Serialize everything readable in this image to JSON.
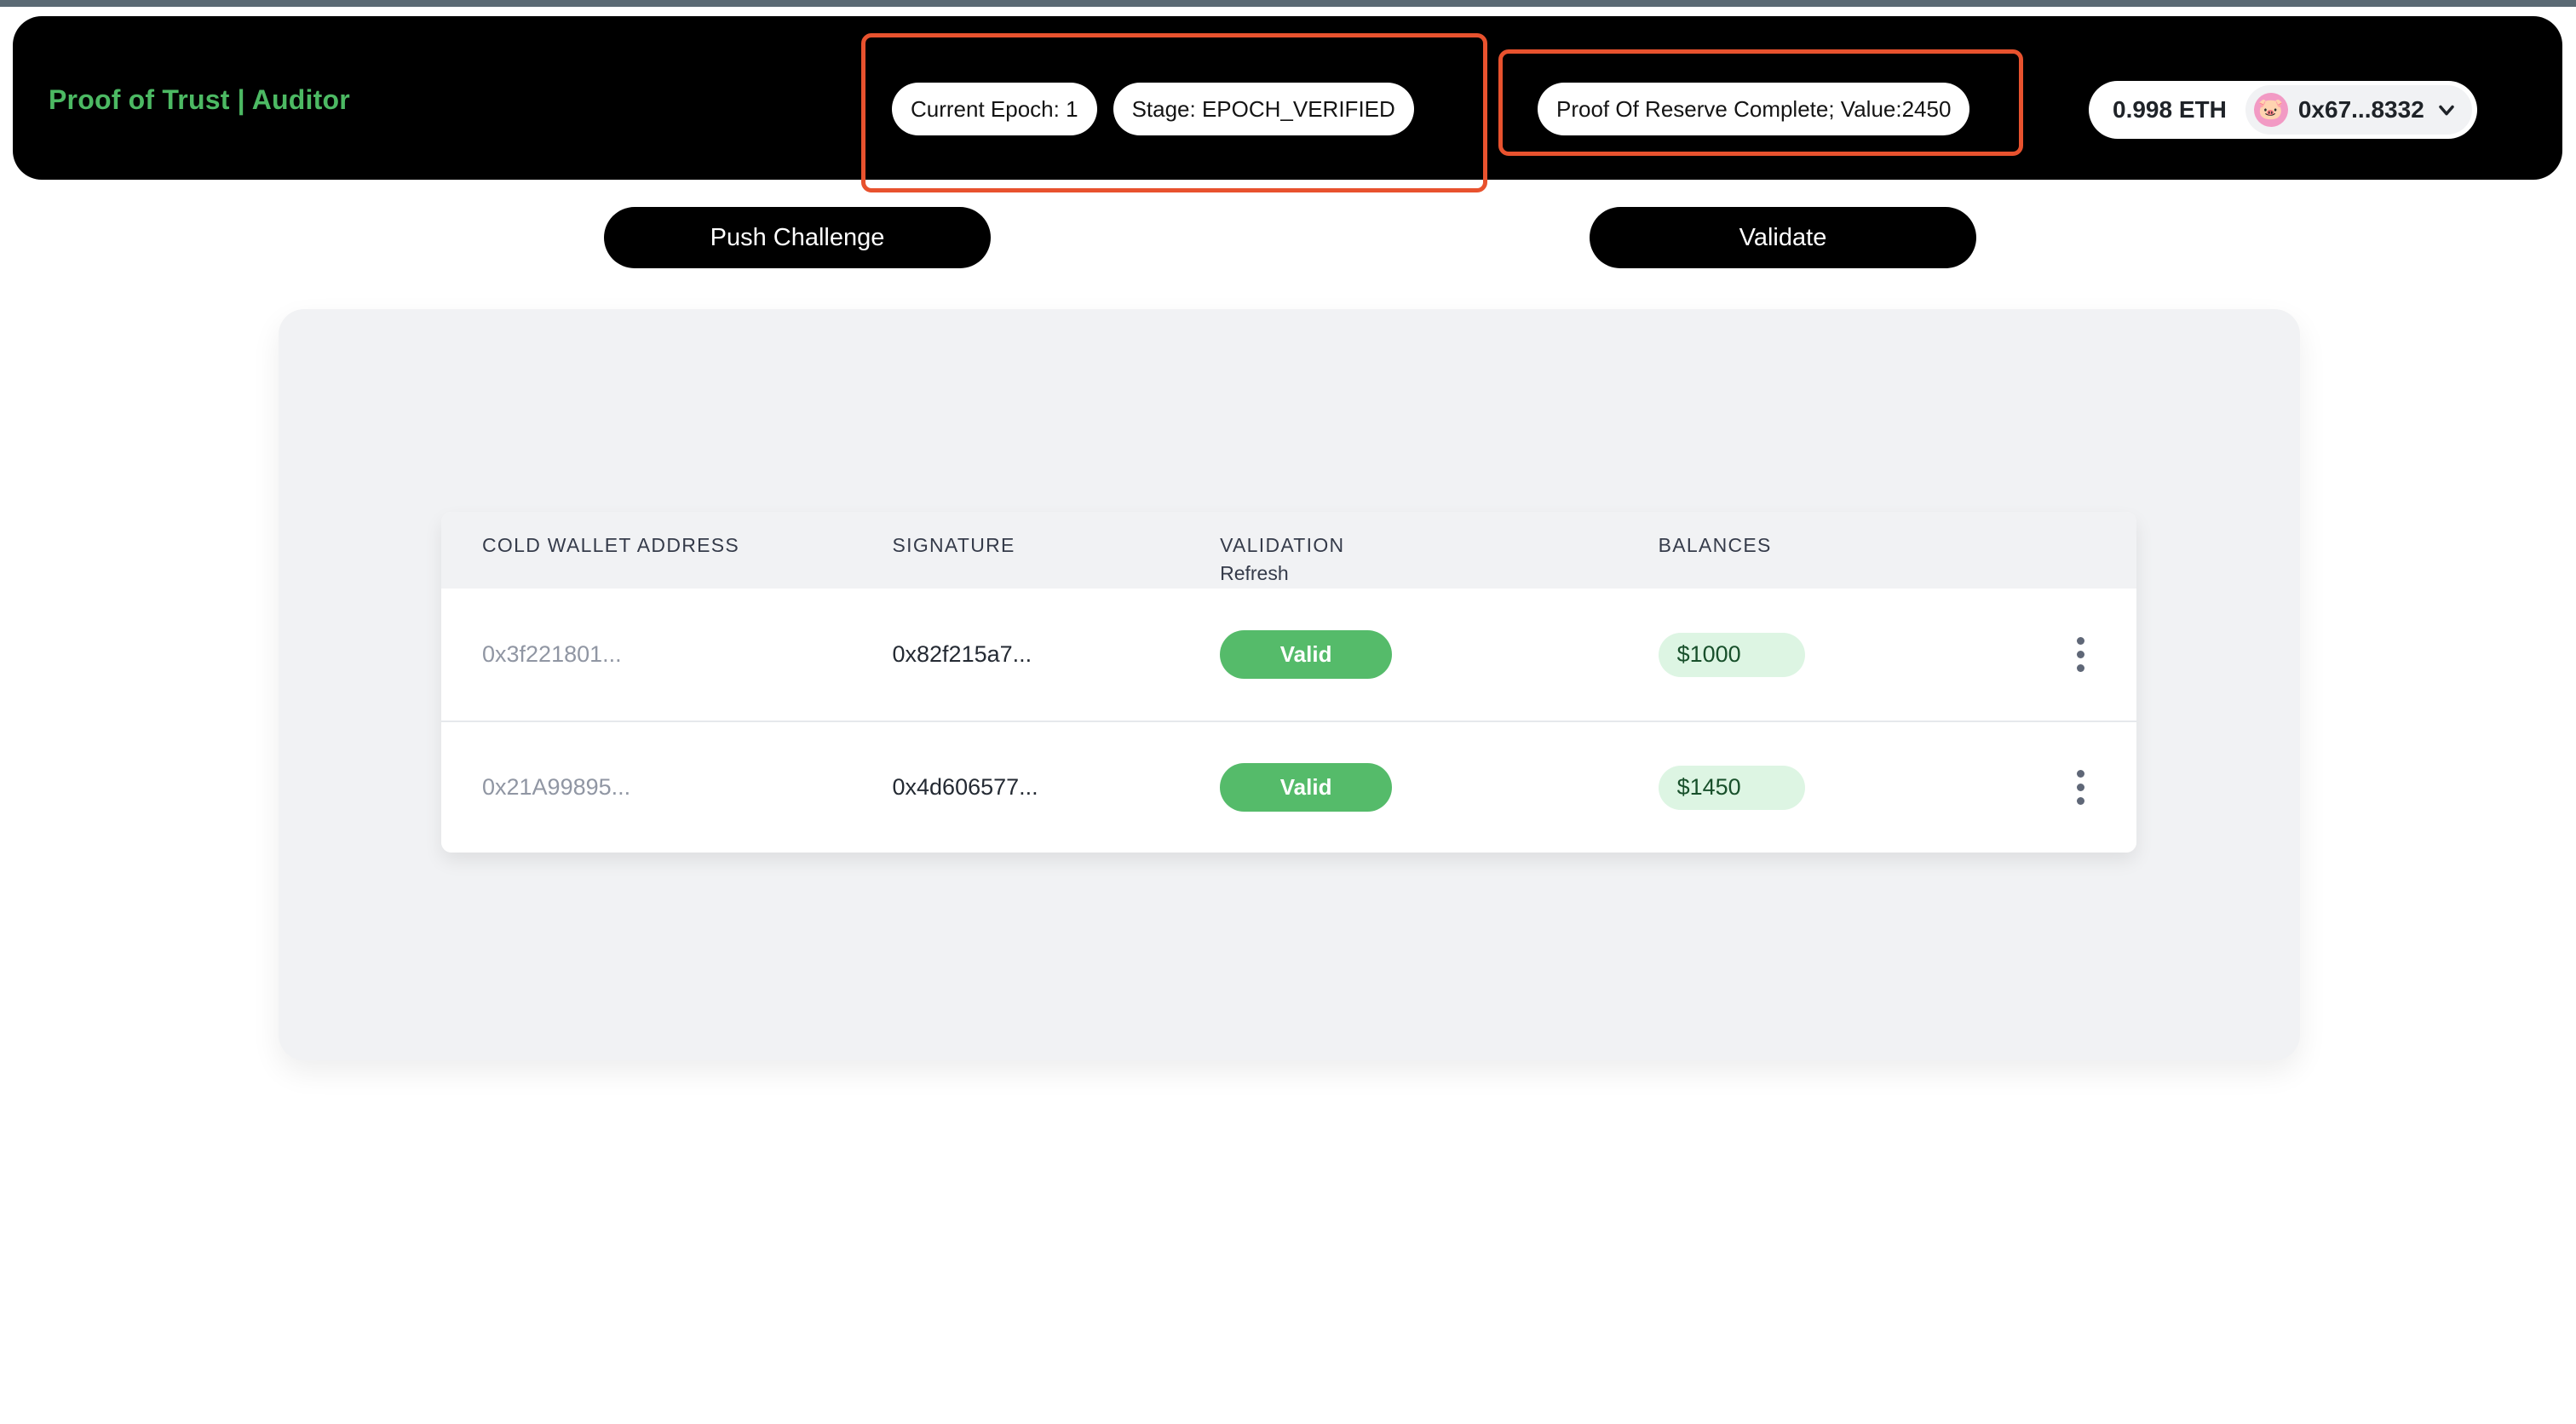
{
  "app": {
    "brand_title": "Proof of Trust | Auditor"
  },
  "header": {
    "status_pills": [
      {
        "label": "Current Epoch: 1",
        "name": "current-epoch-pill"
      },
      {
        "label": "Stage: EPOCH_VERIFIED",
        "name": "stage-pill"
      }
    ],
    "reserve_pill": {
      "label": "Proof Of Reserve Complete; Value:2450"
    },
    "wallet": {
      "balance": "0.998 ETH",
      "address": "0x67...8332",
      "avatar_icon": "pig-avatar-icon",
      "chevron_icon": "chevron-down-icon"
    }
  },
  "actions": {
    "push_challenge_label": "Push Challenge",
    "validate_label": "Validate"
  },
  "table": {
    "columns": [
      {
        "label": "COLD WALLET ADDRESS",
        "sub": ""
      },
      {
        "label": "SIGNATURE",
        "sub": ""
      },
      {
        "label": "VALIDATION",
        "sub": "Refresh"
      },
      {
        "label": "BALANCES",
        "sub": ""
      },
      {
        "label": "",
        "sub": ""
      }
    ],
    "rows": [
      {
        "address": "0x3f221801...",
        "signature": "0x82f215a7...",
        "validation": "Valid",
        "balance": "$1000",
        "menu_icon": "kebab-menu-icon"
      },
      {
        "address": "0x21A99895...",
        "signature": "0x4d606577...",
        "validation": "Valid",
        "balance": "$1450",
        "menu_icon": "kebab-menu-icon"
      }
    ]
  },
  "colors": {
    "brand_green": "#4cb963",
    "annotation_orange": "#e8522e",
    "valid_green": "#55bb6a",
    "balance_green_bg": "#ddf5e3",
    "header_black": "#000000",
    "panel_gray": "#f1f2f4"
  }
}
